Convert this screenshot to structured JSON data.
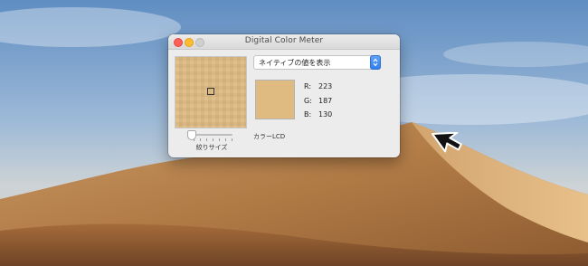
{
  "window": {
    "title": "Digital Color Meter"
  },
  "display_mode": {
    "selected": "ネイティブの値を表示"
  },
  "color": {
    "swatch_hex": "#dfbb82",
    "r_label": "R:",
    "r_value": "223",
    "g_label": "G:",
    "g_value": "187",
    "b_label": "B:",
    "b_value": "130"
  },
  "color_profile": "カラーLCD",
  "aperture": {
    "label": "絞りサイズ",
    "level": 0
  },
  "icons": {
    "close": "close-traffic-light",
    "minimize": "minimize-traffic-light",
    "zoom": "zoom-traffic-light",
    "popup": "up-down-chevron-icon",
    "cursor": "arrow-cursor-icon"
  }
}
